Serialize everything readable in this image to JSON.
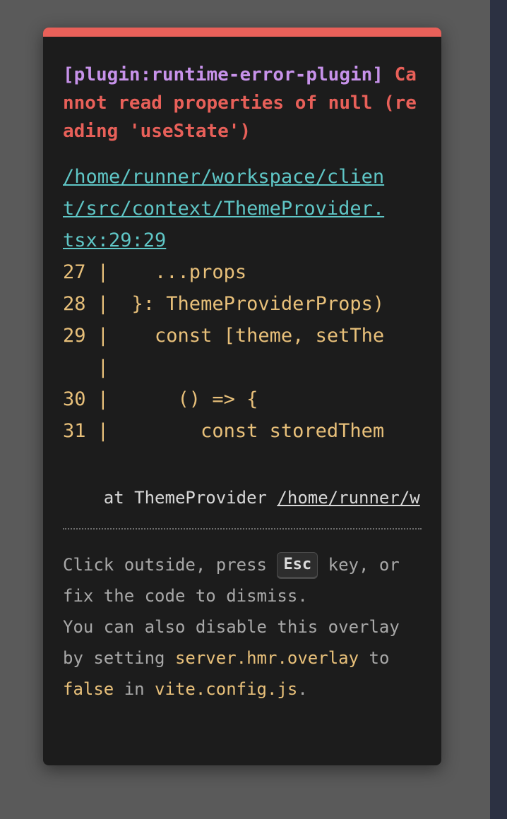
{
  "error": {
    "plugin": "[plugin:runtime-error-plugin]",
    "message": "Cannot read properties of null (reading 'useState')",
    "file_lines": [
      "/home/runner/workspace/clien",
      "t/src/context/ThemeProvider.",
      "tsx:29:29"
    ],
    "frame_lines": [
      "27 |    ...props",
      "28 |  }: ThemeProviderProps)",
      "29 |    const [theme, setThe",
      "   |",
      "30 |      () => {",
      "31 |        const storedThem"
    ],
    "stack_prefix": "    at ThemeProvider ",
    "stack_link": "/home/runner/w"
  },
  "tip": {
    "part1": "Click outside, press ",
    "key": "Esc",
    "part2": " key, or fix the code to dismiss.",
    "part3": "You can also disable this overlay by setting ",
    "code1": "server.hmr.overlay",
    "part4": " to ",
    "code2": "false",
    "part5": " in ",
    "code3": "vite.config.js",
    "part6": "."
  },
  "colors": {
    "accent_bar": "#e86059",
    "plugin": "#c792ea",
    "message": "#e86059",
    "file_link": "#5fc6c6",
    "code": "#e8c07a"
  }
}
